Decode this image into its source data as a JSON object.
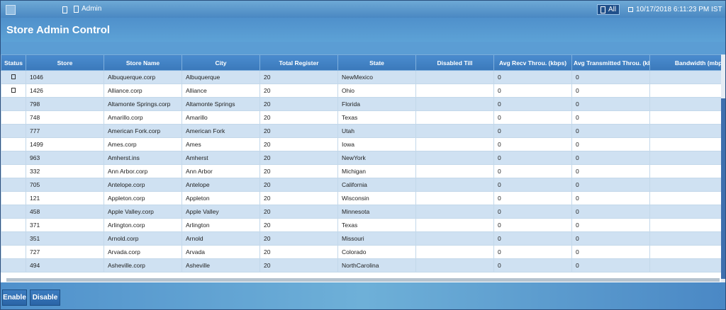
{
  "header": {
    "breadcrumb": "Admin",
    "all_label": "All",
    "datetime": "10/17/2018 6:11:23 PM IST"
  },
  "page": {
    "title": "Store Admin Control"
  },
  "table": {
    "columns": [
      "Status",
      "Store",
      "Store Name",
      "City",
      "Total Register",
      "State",
      "Disabled Till",
      "Avg Recv Throu. (kbps)",
      "Avg Transmitted Throu. (kbps)",
      "Bandwidth (mbps)"
    ],
    "rows": [
      {
        "checkbox": true,
        "store": "1046",
        "name": "Albuquerque.corp",
        "city": "Albuquerque",
        "registers": "20",
        "state": "NewMexico",
        "disabled": "",
        "recv": "0",
        "trans": "0",
        "bw": ""
      },
      {
        "checkbox": true,
        "store": "1426",
        "name": "Alliance.corp",
        "city": "Alliance",
        "registers": "20",
        "state": "Ohio",
        "disabled": "",
        "recv": "0",
        "trans": "0",
        "bw": ""
      },
      {
        "checkbox": false,
        "store": "798",
        "name": "Altamonte Springs.corp",
        "city": "Altamonte Springs",
        "registers": "20",
        "state": "Florida",
        "disabled": "",
        "recv": "0",
        "trans": "0",
        "bw": ""
      },
      {
        "checkbox": false,
        "store": "748",
        "name": "Amarillo.corp",
        "city": "Amarillo",
        "registers": "20",
        "state": "Texas",
        "disabled": "",
        "recv": "0",
        "trans": "0",
        "bw": ""
      },
      {
        "checkbox": false,
        "store": "777",
        "name": "American Fork.corp",
        "city": "American Fork",
        "registers": "20",
        "state": "Utah",
        "disabled": "",
        "recv": "0",
        "trans": "0",
        "bw": ""
      },
      {
        "checkbox": false,
        "store": "1499",
        "name": "Ames.corp",
        "city": "Ames",
        "registers": "20",
        "state": "Iowa",
        "disabled": "",
        "recv": "0",
        "trans": "0",
        "bw": ""
      },
      {
        "checkbox": false,
        "store": "963",
        "name": "Amherst.ins",
        "city": "Amherst",
        "registers": "20",
        "state": "NewYork",
        "disabled": "",
        "recv": "0",
        "trans": "0",
        "bw": ""
      },
      {
        "checkbox": false,
        "store": "332",
        "name": "Ann Arbor.corp",
        "city": "Ann Arbor",
        "registers": "20",
        "state": "Michigan",
        "disabled": "",
        "recv": "0",
        "trans": "0",
        "bw": ""
      },
      {
        "checkbox": false,
        "store": "705",
        "name": "Antelope.corp",
        "city": "Antelope",
        "registers": "20",
        "state": "California",
        "disabled": "",
        "recv": "0",
        "trans": "0",
        "bw": ""
      },
      {
        "checkbox": false,
        "store": "121",
        "name": "Appleton.corp",
        "city": "Appleton",
        "registers": "20",
        "state": "Wisconsin",
        "disabled": "",
        "recv": "0",
        "trans": "0",
        "bw": ""
      },
      {
        "checkbox": false,
        "store": "458",
        "name": "Apple Valley.corp",
        "city": "Apple Valley",
        "registers": "20",
        "state": "Minnesota",
        "disabled": "",
        "recv": "0",
        "trans": "0",
        "bw": ""
      },
      {
        "checkbox": false,
        "store": "371",
        "name": "Arlington.corp",
        "city": "Arlington",
        "registers": "20",
        "state": "Texas",
        "disabled": "",
        "recv": "0",
        "trans": "0",
        "bw": ""
      },
      {
        "checkbox": false,
        "store": "351",
        "name": "Arnold.corp",
        "city": "Arnold",
        "registers": "20",
        "state": "Missouri",
        "disabled": "",
        "recv": "0",
        "trans": "0",
        "bw": ""
      },
      {
        "checkbox": false,
        "store": "727",
        "name": "Arvada.corp",
        "city": "Arvada",
        "registers": "20",
        "state": "Colorado",
        "disabled": "",
        "recv": "0",
        "trans": "0",
        "bw": ""
      },
      {
        "checkbox": false,
        "store": "494",
        "name": "Asheville.corp",
        "city": "Asheville",
        "registers": "20",
        "state": "NorthCarolina",
        "disabled": "",
        "recv": "0",
        "trans": "0",
        "bw": ""
      }
    ]
  },
  "footer": {
    "enable_label": "Enable",
    "disable_label": "Disable"
  },
  "colors": {
    "header_blue": "#4a8ccf",
    "row_alt": "#cfe1f2",
    "button_blue": "#2a64a6"
  }
}
